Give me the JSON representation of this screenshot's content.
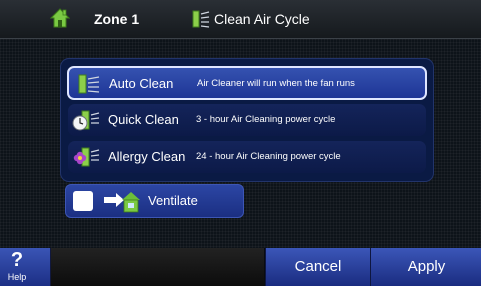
{
  "header": {
    "zone": "Zone 1",
    "mode": "Clean Air Cycle"
  },
  "options": [
    {
      "name": "Auto Clean",
      "description": "Air Cleaner will run when the fan runs",
      "selected": true,
      "icon": "air-filter-icon"
    },
    {
      "name": "Quick Clean",
      "description": "3 - hour Air Cleaning power cycle",
      "selected": false,
      "icon": "clock-filter-icon"
    },
    {
      "name": "Allergy Clean",
      "description": "24 - hour Air Cleaning power cycle",
      "selected": false,
      "icon": "flower-filter-icon"
    }
  ],
  "ventilate": {
    "label": "Ventilate",
    "checked": false,
    "icon": "ventilate-icon"
  },
  "footer": {
    "help_symbol": "?",
    "help_label": "Help",
    "cancel": "Cancel",
    "apply": "Apply"
  },
  "colors": {
    "background": "#0d1319",
    "panel": "#0a1a44",
    "button": "#2c46a4",
    "selected": "#3552b0",
    "home_icon": "#7ac943",
    "filter_icon": "#8ccf4a"
  }
}
